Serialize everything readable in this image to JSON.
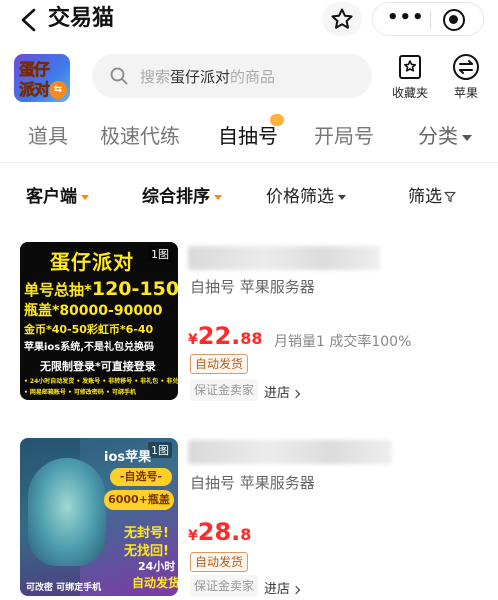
{
  "header": {
    "title": "交易猫",
    "back_icon": "chevron-left-icon",
    "star_icon": "star-outline-icon",
    "more_icon": "more-dots-icon",
    "target_icon": "target-icon"
  },
  "search": {
    "game_logo_line1": "蛋仔",
    "game_logo_line2": "派对",
    "placeholder_prefix": "搜索",
    "placeholder_highlight": "蛋仔派对",
    "placeholder_suffix": "的商品",
    "favorites_label": "收藏夹",
    "platform_label": "苹果"
  },
  "tabs": [
    {
      "label": "道具",
      "active": false
    },
    {
      "label": "极速代练",
      "active": false
    },
    {
      "label": "自抽号",
      "active": true
    },
    {
      "label": "开局号",
      "active": false
    }
  ],
  "more_tab": "分类",
  "filters": {
    "client": "客户端",
    "sort": "综合排序",
    "price": "价格筛选",
    "filter": "筛选"
  },
  "listings": [
    {
      "image_tag": "1图",
      "image": {
        "title": "蛋仔派对",
        "line1_prefix": "单号总抽*",
        "line1_value": "120-150",
        "line2": "瓶盖*80000-90000",
        "line3": "金币*40-50彩虹币*6-40",
        "line4": "苹果ios系统,不是礼包兑换码",
        "line5": "无限制登录*可直接登录",
        "line6": "• 24小时自动发货 • 发账号 • 非转移号 • 非礼包 • 非兑换码",
        "line7": "• 网易邮箱账号 • 可修改密码 • 可绑手机"
      },
      "subtitle": "自抽号 苹果服务器",
      "price_symbol": "¥",
      "price_int": "22.",
      "price_dec": "88",
      "stats": "月销量1 成交率100%",
      "tag": "自动发货",
      "seller": "保证金卖家",
      "enter": "进店"
    },
    {
      "image_tag": "1图",
      "image": {
        "line1": "ios苹果",
        "line2": "-自选号-",
        "line3": "6000+瓶盖",
        "line4": "无封号!",
        "line5": "无找回!",
        "line6": "24小时",
        "line7": "自动发货",
        "footer": "可改密  可绑定手机"
      },
      "subtitle": "自抽号 苹果服务器",
      "price_symbol": "¥",
      "price_int": "28.",
      "price_dec": "8",
      "tag": "自动发货",
      "seller": "保证金卖家",
      "enter": "进店"
    }
  ],
  "colors": {
    "price": "#ff2a2a",
    "accent": "#ff8a00",
    "tag_text": "#b25e1c"
  }
}
